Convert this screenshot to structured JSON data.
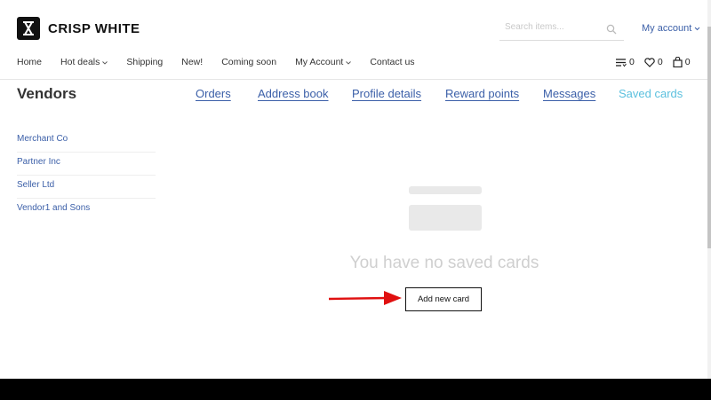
{
  "brand": {
    "name": "CRISP WHITE"
  },
  "search": {
    "placeholder": "Search items..."
  },
  "account": {
    "label": "My account"
  },
  "nav": {
    "items": [
      {
        "label": "Home",
        "dropdown": false
      },
      {
        "label": "Hot deals",
        "dropdown": true
      },
      {
        "label": "Shipping",
        "dropdown": false
      },
      {
        "label": "New!",
        "dropdown": false
      },
      {
        "label": "Coming soon",
        "dropdown": false
      },
      {
        "label": "My Account",
        "dropdown": true
      },
      {
        "label": "Contact us",
        "dropdown": false
      }
    ]
  },
  "counters": {
    "compare": "0",
    "wishlist": "0",
    "cart": "0"
  },
  "page": {
    "title": "Vendors"
  },
  "tabs": [
    {
      "label": "Orders",
      "active": false
    },
    {
      "label": "Address book",
      "active": false
    },
    {
      "label": "Profile details",
      "active": false
    },
    {
      "label": "Reward points",
      "active": false
    },
    {
      "label": "Messages",
      "active": false
    },
    {
      "label": "Saved cards",
      "active": true
    }
  ],
  "sidebar": {
    "vendors": [
      "Merchant Co",
      "Partner Inc",
      "Seller Ltd",
      "Vendor1 and Sons"
    ]
  },
  "empty_state": {
    "message": "You have no saved cards",
    "button_label": "Add new card"
  },
  "colors": {
    "link": "#3b5fa8",
    "active_tab": "#5bc0de",
    "annotation_arrow": "#e01010"
  }
}
